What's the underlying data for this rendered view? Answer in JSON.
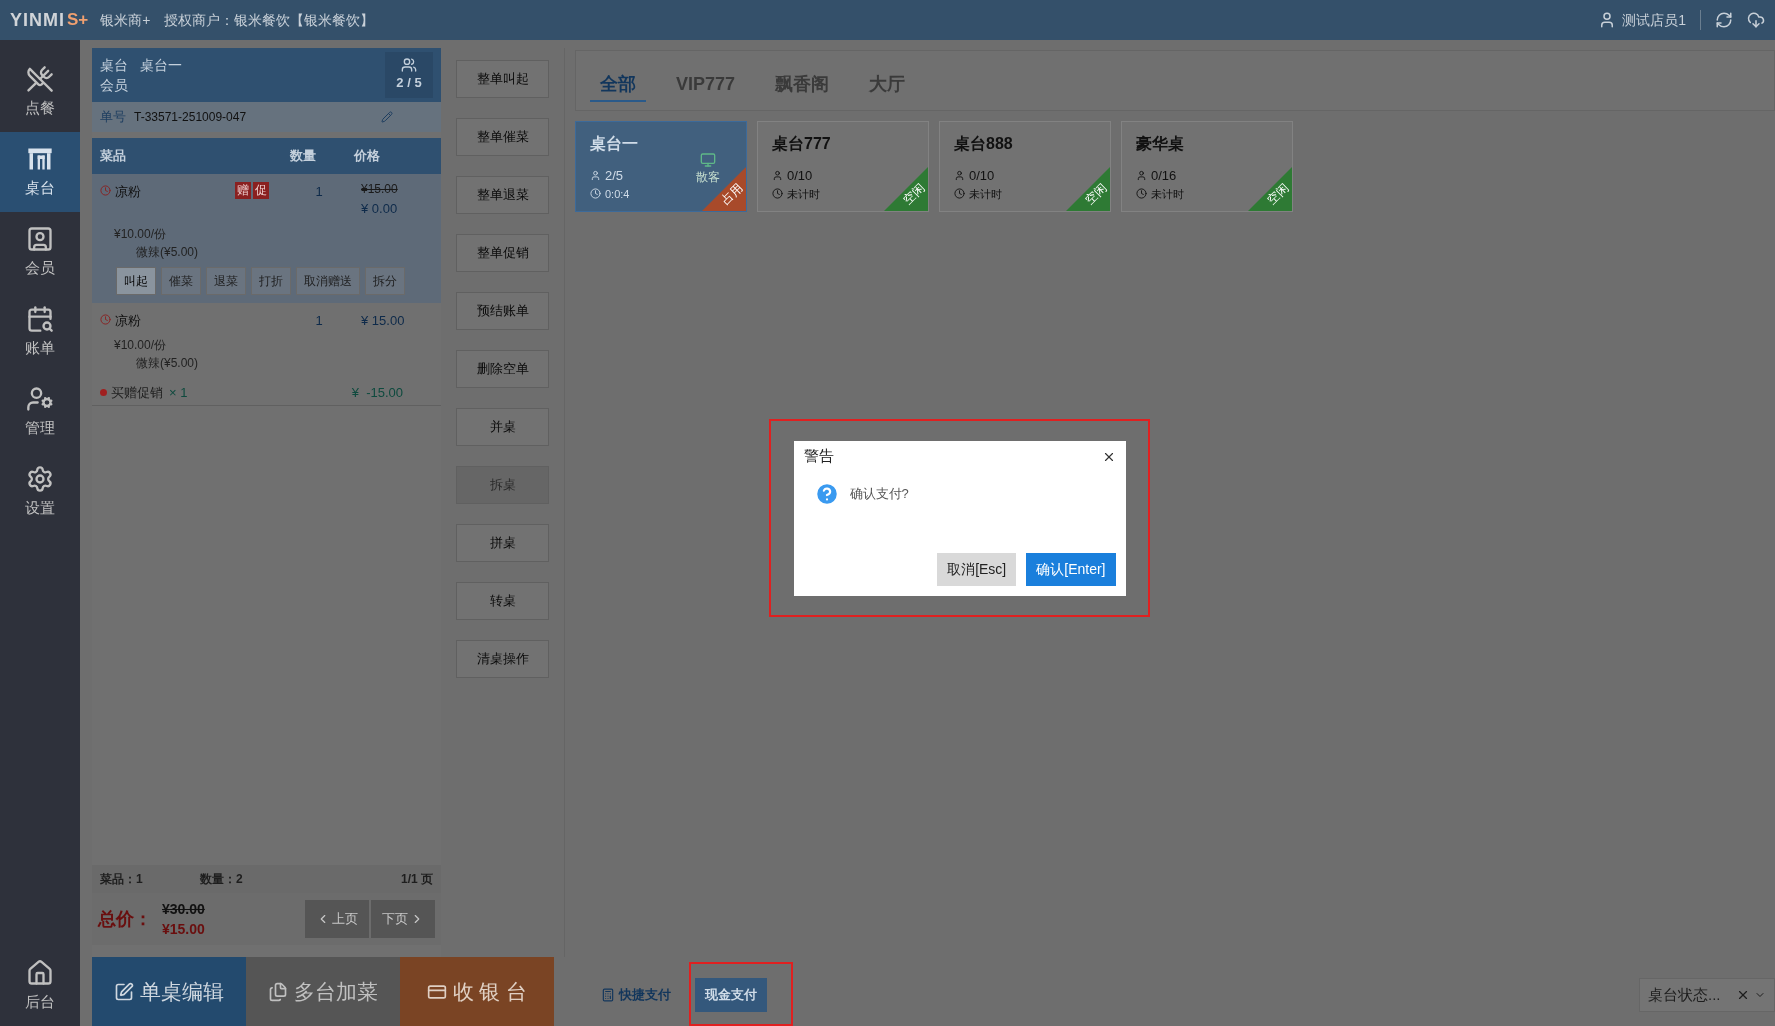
{
  "header": {
    "logo": "YINMI",
    "logo_suffix": "S+",
    "product": "银米商+",
    "merchant": "授权商户：银米餐饮【银米餐饮】",
    "user": "测试店员1"
  },
  "sidebar": {
    "items": [
      {
        "label": "点餐",
        "selected": false
      },
      {
        "label": "桌台",
        "selected": true
      },
      {
        "label": "会员",
        "selected": false
      },
      {
        "label": "账单",
        "selected": false
      },
      {
        "label": "管理",
        "selected": false
      },
      {
        "label": "设置",
        "selected": false
      }
    ],
    "bottom_item": {
      "label": "后台",
      "selected": false
    }
  },
  "order": {
    "table_label": "桌台",
    "table_name": "桌台一",
    "member_label": "会员",
    "guests": "2 / 5",
    "order_no_label": "单号",
    "order_no": "T-33571-251009-047",
    "columns": [
      "菜品",
      "数量",
      "价格"
    ],
    "items": [
      {
        "kind": "dish",
        "name": "凉粉",
        "tags": [
          "赠",
          "促"
        ],
        "qty": "1",
        "original_price": "¥15.00",
        "price": "¥ 0.00",
        "unit_price": "¥10.00/份",
        "option": "微辣(¥5.00)",
        "selected": true,
        "actions": [
          {
            "label": "叫起",
            "disabled": false
          },
          {
            "label": "催菜",
            "disabled": true
          },
          {
            "label": "退菜",
            "disabled": true
          },
          {
            "label": "打折",
            "disabled": true
          },
          {
            "label": "取消赠送",
            "disabled": true
          },
          {
            "label": "拆分",
            "disabled": true
          }
        ]
      },
      {
        "kind": "dish",
        "name": "凉粉",
        "qty": "1",
        "price": "¥ 15.00",
        "unit_price": "¥10.00/份",
        "option": "微辣(¥5.00)",
        "selected": false
      },
      {
        "kind": "promo",
        "name": "买赠促销",
        "qty": "× 1",
        "price": "¥  -15.00"
      }
    ],
    "summary": {
      "dishes": "菜品：1",
      "quantity": "数量：2",
      "page": "1/1 页"
    },
    "total_label": "总价：",
    "total_original": "¥30.00",
    "total": "¥15.00",
    "prev": "上页",
    "next": "下页"
  },
  "bottom_buttons": [
    {
      "label": "单桌编辑",
      "kind": "edit"
    },
    {
      "label": "多台加菜",
      "kind": "multi"
    },
    {
      "label": "收 银 台",
      "kind": "cashier"
    }
  ],
  "actions": [
    {
      "label": "整单叫起",
      "disabled": false
    },
    {
      "label": "整单催菜",
      "disabled": false
    },
    {
      "label": "整单退菜",
      "disabled": false
    },
    {
      "label": "整单促销",
      "disabled": false
    },
    {
      "label": "预结账单",
      "disabled": false
    },
    {
      "label": "删除空单",
      "disabled": false
    },
    {
      "label": "并桌",
      "disabled": false
    },
    {
      "label": "拆桌",
      "disabled": true
    },
    {
      "label": "拼桌",
      "disabled": false
    },
    {
      "label": "转桌",
      "disabled": false
    },
    {
      "label": "清桌操作",
      "disabled": false
    }
  ],
  "area_tabs": [
    {
      "label": "全部",
      "selected": true
    },
    {
      "label": "VIP777",
      "selected": false
    },
    {
      "label": "飘香阁",
      "selected": false
    },
    {
      "label": "大厅",
      "selected": false
    }
  ],
  "tables": [
    {
      "name": "桌台一",
      "seats": "2/5",
      "time": "0:0:4",
      "guest": "散客",
      "status": "占用",
      "color": "#a84a2a",
      "selected": true
    },
    {
      "name": "桌台777",
      "seats": "0/10",
      "time": "未计时",
      "status": "空闲",
      "color": "#2e7a34",
      "selected": false
    },
    {
      "name": "桌台888",
      "seats": "0/10",
      "time": "未计时",
      "status": "空闲",
      "color": "#2e7a34",
      "selected": false
    },
    {
      "name": "豪华桌",
      "seats": "0/16",
      "time": "未计时",
      "status": "空闲",
      "color": "#2e7a34",
      "selected": false
    }
  ],
  "payments": [
    {
      "label": "快捷支付",
      "selected": false,
      "highlighted": false
    },
    {
      "label": "现金支付",
      "selected": true,
      "highlighted": true
    }
  ],
  "status_filter": {
    "value": "桌台状态..."
  },
  "dialog": {
    "title": "警告",
    "message": "确认支付?",
    "cancel": "取消[Esc]",
    "confirm": "确认[Enter]",
    "highlighted": true
  }
}
